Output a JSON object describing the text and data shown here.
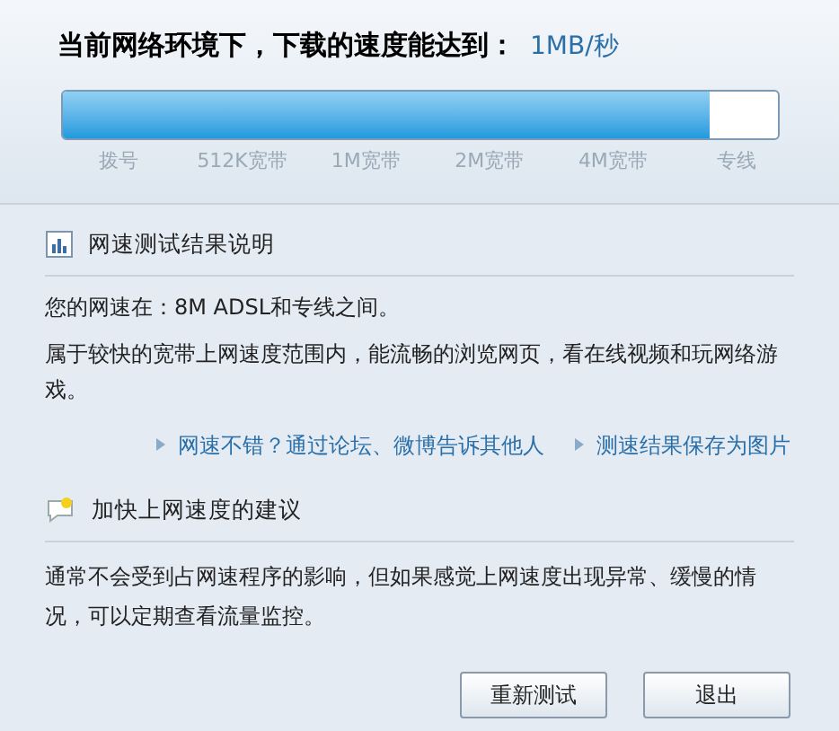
{
  "header": {
    "title": "当前网络环境下，下载的速度能达到：",
    "speed": "1MB/秒"
  },
  "speed_bar": {
    "level": 0.905,
    "ticks": [
      "拨号",
      "512K宽带",
      "1M宽带",
      "2M宽带",
      "4M宽带",
      "专线"
    ]
  },
  "result_section": {
    "title": "网速测试结果说明",
    "lines": [
      "您的网速在：8M ADSL和专线之间。",
      "属于较快的宽带上网速度范围内，能流畅的浏览网页，看在线视频和玩网络游戏。"
    ],
    "links": [
      "网速不错？通过论坛、微博告诉其他人",
      "测速结果保存为图片"
    ]
  },
  "advice_section": {
    "title": "加快上网速度的建议",
    "text": "通常不会受到占网速程序的影响，但如果感觉上网速度出现异常、缓慢的情况，可以定期查看流量监控。"
  },
  "buttons": [
    "重新测试",
    "退出"
  ]
}
